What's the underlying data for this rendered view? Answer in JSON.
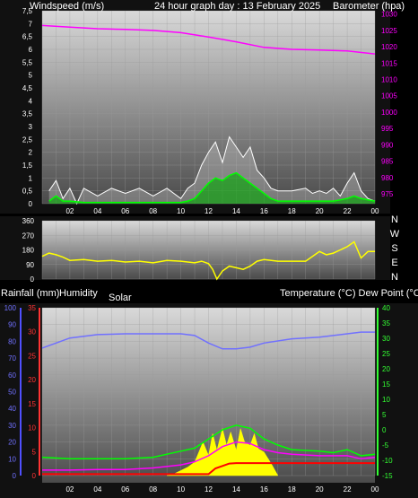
{
  "header": {
    "left": "Windspeed (m/s)",
    "center": "24 hour graph day : 13 February 2025",
    "right": "Barometer (hpa)"
  },
  "middle_header": {
    "left": "Rainfall (mm)",
    "humidity": "Humidity",
    "solar": "Solar",
    "right": "Temperature (°C) Dew Point (°C)"
  },
  "colors": {
    "background": "#000000",
    "plot_top": "#d9d9d9",
    "plot_bottom": "#4a4a4a",
    "wind": "#ffffff",
    "wind_avg": "#00ff00",
    "barometer": "#ff00ff",
    "direction": "#ffff00",
    "humidity": "#7070ff",
    "temperature": "#00ff00",
    "dewpoint": "#ff00ff",
    "solar": "#ffff00",
    "rain": "#ff0000"
  },
  "chart_data": [
    {
      "type": "line",
      "xlabels": [
        "02",
        "04",
        "06",
        "08",
        "10",
        "12",
        "14",
        "16",
        "18",
        "20",
        "22",
        "00"
      ],
      "left_axis": {
        "label": "Windspeed (m/s)",
        "ticks": [
          "0",
          "0,5",
          "1",
          "1,5",
          "2",
          "2,5",
          "3",
          "3,5",
          "4",
          "4,5",
          "5",
          "5,5",
          "6",
          "6,5",
          "7",
          "7,5"
        ],
        "range": [
          0,
          7.5
        ]
      },
      "right_axis": {
        "label": "Barometer (hpa)",
        "ticks": [
          "975",
          "980",
          "985",
          "990",
          "995",
          "1000",
          "1005",
          "1010",
          "1015",
          "1020",
          "1025",
          "1030"
        ],
        "range": [
          972,
          1031
        ]
      },
      "series": [
        {
          "name": "Windspeed",
          "axis": "left",
          "color": "#ffffff",
          "x": [
            0.5,
            1,
            1.5,
            2,
            2.5,
            3,
            4,
            5,
            6,
            7,
            8,
            9,
            10,
            10.5,
            11,
            11.5,
            12,
            12.5,
            13,
            13.5,
            14,
            14.5,
            15,
            15.5,
            16,
            16.5,
            17,
            18,
            19,
            19.5,
            20,
            20.5,
            21,
            21.5,
            22,
            22.5,
            23,
            23.5,
            24
          ],
          "y": [
            0.5,
            0.9,
            0.2,
            0.6,
            0,
            0.6,
            0.3,
            0.6,
            0.4,
            0.6,
            0.3,
            0.6,
            0.2,
            0.6,
            0.8,
            1.5,
            2,
            2.4,
            1.6,
            2.6,
            2.2,
            1.8,
            2.2,
            1.3,
            1.0,
            0.6,
            0.5,
            0.5,
            0.6,
            0.4,
            0.5,
            0.4,
            0.6,
            0.3,
            0.8,
            1.2,
            0.5,
            0.2,
            0.1
          ]
        },
        {
          "name": "Windspeed average",
          "axis": "left",
          "color": "#00ff00",
          "x": [
            0.5,
            1,
            1.5,
            2,
            3,
            4,
            5,
            6,
            7,
            8,
            9,
            10,
            10.5,
            11,
            11.5,
            12,
            12.5,
            13,
            13.5,
            14,
            14.5,
            15,
            15.5,
            16,
            16.5,
            17,
            18,
            19,
            20,
            21,
            22,
            22.5,
            23,
            24
          ],
          "y": [
            0.1,
            0.3,
            0.1,
            0.1,
            0.05,
            0.05,
            0.05,
            0.05,
            0.05,
            0.05,
            0.05,
            0.05,
            0.1,
            0.2,
            0.5,
            0.8,
            1.0,
            0.9,
            1.1,
            1.2,
            1.0,
            0.8,
            0.6,
            0.4,
            0.2,
            0.1,
            0.1,
            0.1,
            0.1,
            0.1,
            0.2,
            0.3,
            0.2,
            0.1
          ]
        },
        {
          "name": "Barometer",
          "axis": "right",
          "color": "#ff00ff",
          "x": [
            0,
            2,
            4,
            6,
            8,
            10,
            12,
            14,
            16,
            18,
            20,
            22,
            24
          ],
          "y": [
            1026.5,
            1026,
            1025.5,
            1025.3,
            1025,
            1024.3,
            1023,
            1021.5,
            1019.8,
            1019.2,
            1019,
            1018.7,
            1017.8
          ]
        }
      ]
    },
    {
      "type": "line",
      "xlabels": [],
      "left_axis": {
        "ticks": [
          "0",
          "90",
          "180",
          "270",
          "360"
        ],
        "range": [
          0,
          360
        ]
      },
      "right_axis": {
        "ticks": [
          "N",
          "W",
          "S",
          "E",
          "N"
        ]
      },
      "series": [
        {
          "name": "Wind direction",
          "color": "#ffff00",
          "x": [
            0,
            0.5,
            1,
            1.5,
            2,
            3,
            4,
            5,
            6,
            7,
            8,
            9,
            10,
            11,
            11.5,
            12,
            12.3,
            12.6,
            13,
            13.5,
            14,
            14.5,
            15,
            15.5,
            16,
            17,
            18,
            19,
            20,
            20.5,
            21,
            21.5,
            22,
            22.5,
            23,
            23.5,
            24
          ],
          "y": [
            140,
            160,
            150,
            135,
            115,
            120,
            110,
            115,
            105,
            110,
            100,
            115,
            110,
            100,
            110,
            95,
            60,
            0,
            50,
            80,
            70,
            60,
            80,
            110,
            120,
            110,
            110,
            110,
            170,
            150,
            160,
            180,
            200,
            230,
            130,
            170,
            170
          ]
        }
      ]
    },
    {
      "type": "line",
      "xlabels": [
        "02",
        "04",
        "06",
        "08",
        "10",
        "12",
        "14",
        "16",
        "18",
        "20",
        "22",
        "00"
      ],
      "humidity_axis": {
        "ticks": [
          "0",
          "10",
          "20",
          "30",
          "40",
          "50",
          "60",
          "70",
          "80",
          "90",
          "100"
        ],
        "range": [
          0,
          100
        ]
      },
      "rain_axis": {
        "ticks": [
          "0",
          "5",
          "10",
          "15",
          "20",
          "25",
          "30",
          "35"
        ],
        "range": [
          0,
          35
        ]
      },
      "temperature_axis": {
        "ticks": [
          "-15",
          "-10",
          "-5",
          "0",
          "5",
          "10",
          "15",
          "20",
          "25",
          "30",
          "35",
          "40"
        ],
        "range": [
          -15,
          40
        ]
      },
      "series": [
        {
          "name": "Humidity",
          "axis": "humidity",
          "color": "#7070ff",
          "x": [
            0,
            1,
            2,
            4,
            6,
            8,
            10,
            11,
            12,
            13,
            14,
            15,
            16,
            18,
            20,
            22,
            23,
            24
          ],
          "y": [
            76,
            79,
            82,
            84,
            84.5,
            84.5,
            84.5,
            83.5,
            79,
            75.5,
            75.5,
            76.5,
            79,
            81.5,
            82.5,
            84.5,
            85.5,
            85.5
          ]
        },
        {
          "name": "Temperature",
          "axis": "temperature",
          "color": "#00ff00",
          "x": [
            0,
            2,
            4,
            6,
            8,
            9,
            10,
            11,
            12,
            13,
            14,
            15,
            16,
            17,
            18,
            20,
            21,
            22,
            23,
            24
          ],
          "y": [
            -9,
            -9.5,
            -9.5,
            -9.5,
            -9,
            -8,
            -7,
            -6,
            -3,
            0,
            1.5,
            0.5,
            -3,
            -5,
            -6.5,
            -7,
            -7.5,
            -6.5,
            -8.5,
            -8
          ]
        },
        {
          "name": "Dew Point",
          "axis": "temperature",
          "color": "#ff00ff",
          "x": [
            0,
            2,
            4,
            6,
            8,
            10,
            11,
            12,
            13,
            14,
            15,
            16,
            17,
            18,
            20,
            22,
            23,
            24
          ],
          "y": [
            -13.2,
            -13.2,
            -13,
            -13,
            -12.5,
            -11.5,
            -10.5,
            -8.5,
            -5.5,
            -4,
            -4.5,
            -6.5,
            -7.5,
            -8,
            -8.5,
            -8.5,
            -9.5,
            -9
          ]
        },
        {
          "name": "Solar",
          "axis": "humidity",
          "color": "#ffff00",
          "x": [
            9,
            9.5,
            10,
            10.5,
            11,
            11.3,
            11.6,
            12,
            12.3,
            12.6,
            13,
            13.3,
            13.6,
            14,
            14.3,
            14.6,
            15,
            15.3,
            15.6,
            16,
            16.3,
            16.6,
            17
          ],
          "y": [
            0,
            1,
            3,
            5,
            8,
            14,
            20,
            12,
            25,
            15,
            28,
            18,
            26,
            15,
            28,
            20,
            18,
            25,
            16,
            14,
            10,
            6,
            0
          ]
        },
        {
          "name": "Rainfall",
          "axis": "rain",
          "color": "#ff0000",
          "x": [
            0,
            12,
            12.5,
            13,
            13.5,
            14,
            24
          ],
          "y": [
            0.3,
            0.3,
            1.5,
            2,
            2.5,
            2.6,
            2.6
          ]
        }
      ]
    }
  ]
}
